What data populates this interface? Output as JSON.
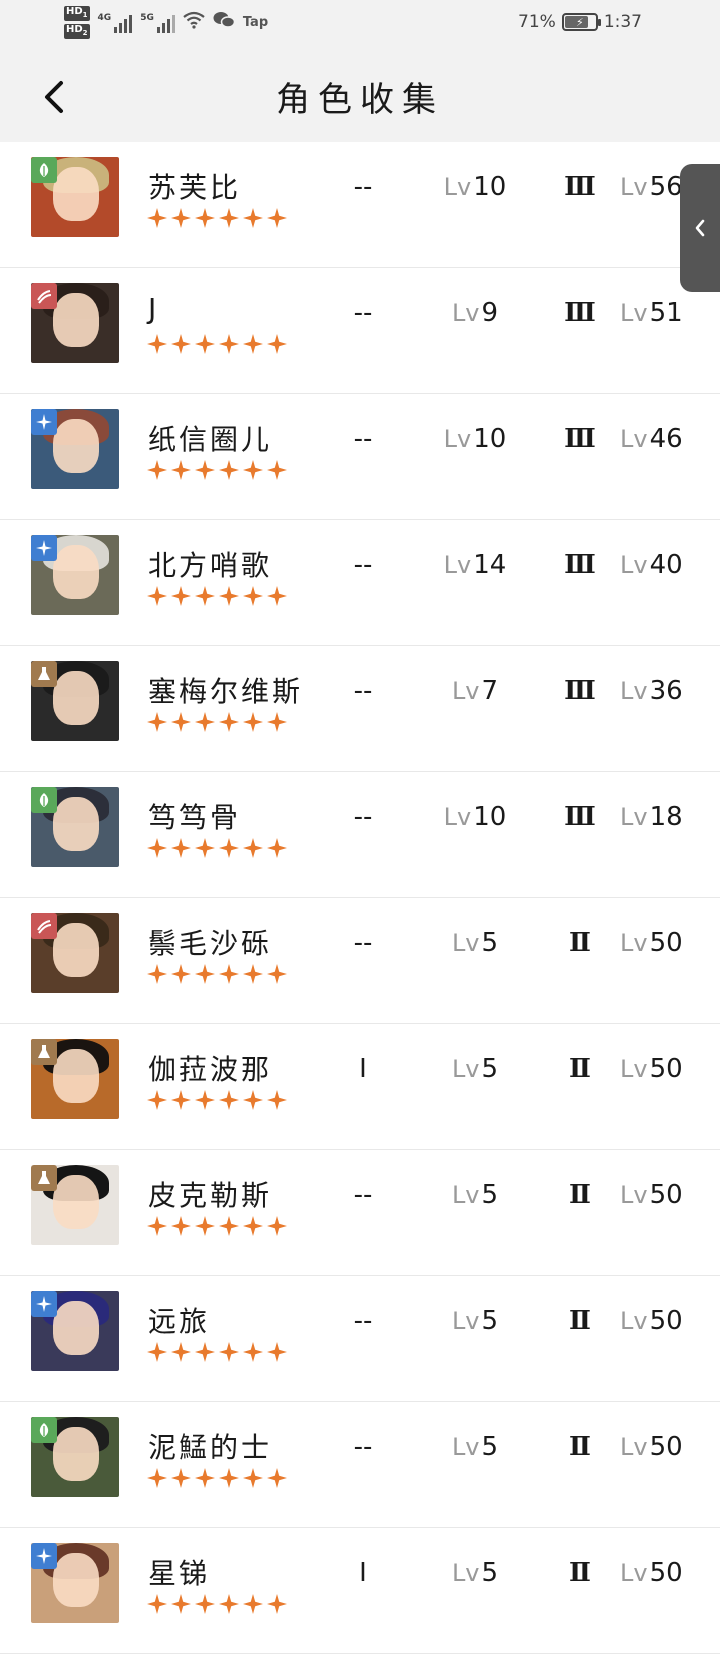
{
  "status_bar": {
    "hd1": "HD",
    "hd1_sub": "1",
    "hd2": "HD",
    "hd2_sub": "2",
    "net1": "4G",
    "net2": "5G",
    "app": "Tap",
    "battery_percent": "71%",
    "battery_level": 0.71,
    "time": "1:37"
  },
  "header": {
    "title": "角色收集"
  },
  "colors": {
    "star": "#e87a2d",
    "badge_green": "#5aa85a",
    "badge_red": "#c95656",
    "badge_blue": "#3f7ed1",
    "badge_brown": "#a07a4f"
  },
  "characters": [
    {
      "name": "苏芙比",
      "stars": 6,
      "col_a": "--",
      "lv": "Lv",
      "level": "10",
      "tier": "Ⅲ",
      "level2": "56",
      "badge": "leaf-icon",
      "badge_color": "#5aa85a",
      "hair": "#c9b27a",
      "bg": "#b34a2a"
    },
    {
      "name": "J",
      "stars": 6,
      "col_a": "--",
      "lv": "Lv",
      "level": "9",
      "tier": "Ⅲ",
      "level2": "51",
      "badge": "claw-icon",
      "badge_color": "#c95656",
      "hair": "#2a1f1a",
      "bg": "#3a2e28"
    },
    {
      "name": "纸信圈儿",
      "stars": 6,
      "col_a": "--",
      "lv": "Lv",
      "level": "10",
      "tier": "Ⅲ",
      "level2": "46",
      "badge": "star-spark-icon",
      "badge_color": "#3f7ed1",
      "hair": "#8a4a3a",
      "bg": "#3b5a7a"
    },
    {
      "name": "北方哨歌",
      "stars": 6,
      "col_a": "--",
      "lv": "Lv",
      "level": "14",
      "tier": "Ⅲ",
      "level2": "40",
      "badge": "star-spark-icon",
      "badge_color": "#3f7ed1",
      "hair": "#d8d6cf",
      "bg": "#6b6a58"
    },
    {
      "name": "塞梅尔维斯",
      "stars": 6,
      "col_a": "--",
      "lv": "Lv",
      "level": "7",
      "tier": "Ⅲ",
      "level2": "36",
      "badge": "flask-icon",
      "badge_color": "#a07a4f",
      "hair": "#1b1b1b",
      "bg": "#2a2a2a"
    },
    {
      "name": "笃笃骨",
      "stars": 6,
      "col_a": "--",
      "lv": "Lv",
      "level": "10",
      "tier": "Ⅲ",
      "level2": "18",
      "badge": "leaf-icon",
      "badge_color": "#5aa85a",
      "hair": "#2c2f3a",
      "bg": "#4a5a6a"
    },
    {
      "name": "鬃毛沙砾",
      "stars": 6,
      "col_a": "--",
      "lv": "Lv",
      "level": "5",
      "tier": "Ⅱ",
      "level2": "50",
      "badge": "claw-icon",
      "badge_color": "#c95656",
      "hair": "#3a2a1a",
      "bg": "#5a3e2a"
    },
    {
      "name": "伽菈波那",
      "stars": 6,
      "col_a": "Ⅰ",
      "lv": "Lv",
      "level": "5",
      "tier": "Ⅱ",
      "level2": "50",
      "badge": "flask-icon",
      "badge_color": "#a07a4f",
      "hair": "#1a1410",
      "bg": "#b86a2a"
    },
    {
      "name": "皮克勒斯",
      "stars": 6,
      "col_a": "--",
      "lv": "Lv",
      "level": "5",
      "tier": "Ⅱ",
      "level2": "50",
      "badge": "flask-icon",
      "badge_color": "#a07a4f",
      "hair": "#151515",
      "bg": "#e8e4df"
    },
    {
      "name": "远旅",
      "stars": 6,
      "col_a": "--",
      "lv": "Lv",
      "level": "5",
      "tier": "Ⅱ",
      "level2": "50",
      "badge": "star-spark-icon",
      "badge_color": "#3f7ed1",
      "hair": "#2a2a7a",
      "bg": "#3a3a5a"
    },
    {
      "name": "泥鯭的士",
      "stars": 6,
      "col_a": "--",
      "lv": "Lv",
      "level": "5",
      "tier": "Ⅱ",
      "level2": "50",
      "badge": "leaf-icon",
      "badge_color": "#5aa85a",
      "hair": "#1e1e1e",
      "bg": "#4a5a3a"
    },
    {
      "name": "星锑",
      "stars": 6,
      "col_a": "Ⅰ",
      "lv": "Lv",
      "level": "5",
      "tier": "Ⅱ",
      "level2": "50",
      "badge": "star-spark-icon",
      "badge_color": "#3f7ed1",
      "hair": "#6a3a2a",
      "bg": "#c9a07a"
    }
  ]
}
